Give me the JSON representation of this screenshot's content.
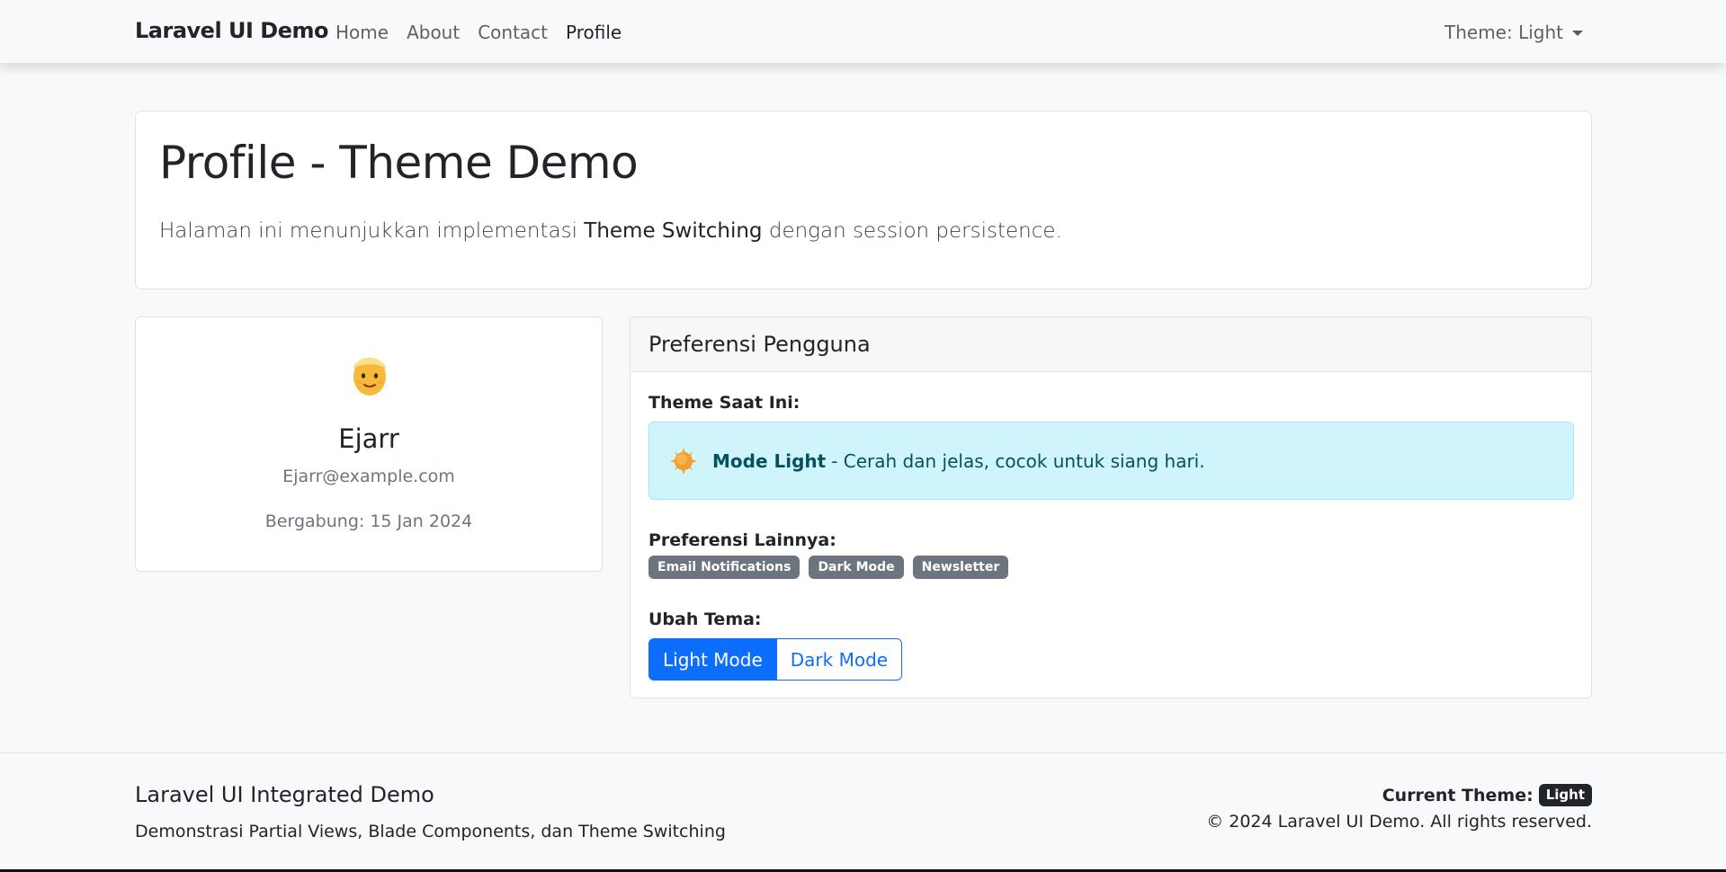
{
  "navbar": {
    "brand": "Laravel UI Demo",
    "links": [
      "Home",
      "About",
      "Contact",
      "Profile"
    ],
    "active_link": "Profile",
    "theme_toggle_label": "Theme: Light"
  },
  "hero": {
    "title": "Profile - Theme Demo",
    "lead_prefix": "Halaman ini menunjukkan implementasi ",
    "lead_highlight": "Theme Switching",
    "lead_suffix": " dengan session persistence."
  },
  "profile": {
    "avatar_icon": "person-avatar-icon",
    "name": "Ejarr",
    "email": "Ejarr@example.com",
    "joined": "Bergabung: 15 Jan 2024"
  },
  "preferences": {
    "header": "Preferensi Pengguna",
    "current_theme_label": "Theme Saat Ini:",
    "alert_icon": "sun-icon",
    "alert_mode": "Mode Light",
    "alert_desc": "- Cerah dan jelas, cocok untuk siang hari.",
    "other_label": "Preferensi Lainnya:",
    "badges": [
      "Email Notifications",
      "Dark Mode",
      "Newsletter"
    ],
    "change_theme_label": "Ubah Tema:",
    "light_button": "Light Mode",
    "dark_button": "Dark Mode"
  },
  "footer": {
    "title": "Laravel UI Integrated Demo",
    "subtitle": "Demonstrasi Partial Views, Blade Components, dan Theme Switching",
    "current_theme_label": "Current Theme:",
    "current_theme_value": "Light",
    "copyright": "© 2024 Laravel UI Demo. All rights reserved."
  },
  "colors": {
    "primary": "#0d6efd",
    "info_bg": "#cff4fc",
    "info_text": "#055160",
    "badge_secondary": "#6c757d",
    "badge_dark": "#212529"
  }
}
